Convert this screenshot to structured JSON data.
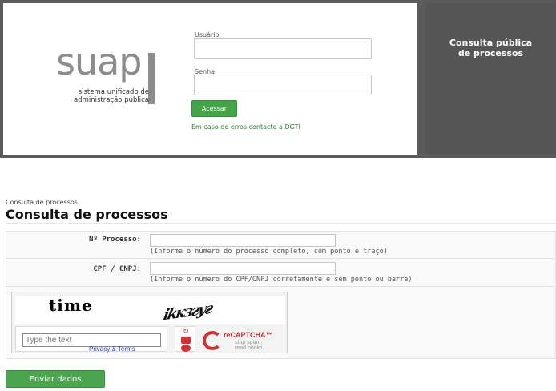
{
  "login": {
    "logo_word": "suap",
    "logo_subtitle": "sistema unificado de administração pública",
    "username_label": "Usuário:",
    "username_value": "",
    "password_label": "Senha:",
    "password_value": "",
    "submit_label": "Acessar",
    "contact_text": "Em caso de erros contacte a DGTI"
  },
  "public_panel": {
    "title_line1": "Consulta pública",
    "title_line2": "de processos"
  },
  "section": {
    "breadcrumb": "Consulta de processos",
    "title": "Consulta de processos"
  },
  "form": {
    "rows": [
      {
        "label": "Nº Processo:",
        "value": "",
        "help": "(Informe o número do processo completo, com ponto e traço)"
      },
      {
        "label": "CPF / CNPJ:",
        "value": "",
        "help": "(Informe o número do CPF/CNPJ corretamente e sem ponto ou barra)"
      }
    ],
    "submit_label": "Enviar dados"
  },
  "captcha": {
    "word1": "time",
    "word2": "ikкзгуг",
    "placeholder": "Type the text",
    "privacy": "Privacy & Terms",
    "brand": "reCAPTCHA™",
    "slogan1": "stop spam.",
    "slogan2": "read books.",
    "colors": {
      "accent": "#cc3333"
    }
  },
  "colors": {
    "green": "#45a349",
    "dark_panel": "#565656"
  }
}
